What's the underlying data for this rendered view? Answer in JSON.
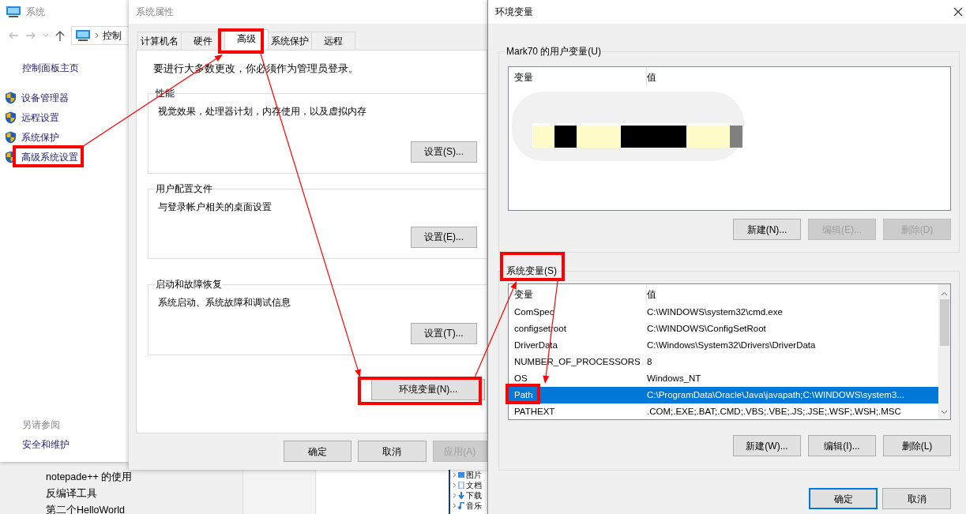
{
  "background_window": {
    "items": [
      {
        "label": "notepade++ 的使用"
      },
      {
        "label": "反编译工具"
      },
      {
        "label": "第二个HelloWorld"
      }
    ]
  },
  "explorer_tree": {
    "items": [
      {
        "label": "图片"
      },
      {
        "label": "文档"
      },
      {
        "label": "下载"
      },
      {
        "label": "音乐"
      }
    ]
  },
  "system_window": {
    "title": "系统",
    "address": "控制",
    "home_link": "控制面板主页",
    "tasks": [
      {
        "label": "设备管理器"
      },
      {
        "label": "远程设置"
      },
      {
        "label": "系统保护"
      },
      {
        "label": "高级系统设置"
      }
    ],
    "see_also_heading": "另请参阅",
    "see_also": [
      {
        "label": "安全和维护"
      }
    ]
  },
  "system_properties": {
    "title": "系统属性",
    "tabs": [
      {
        "label": "计算机名",
        "selected": false
      },
      {
        "label": "硬件",
        "selected": false
      },
      {
        "label": "高级",
        "selected": true
      },
      {
        "label": "系统保护",
        "selected": false
      },
      {
        "label": "远程",
        "selected": false
      }
    ],
    "admin_note": "要进行大多数更改，你必须作为管理员登录。",
    "groups": [
      {
        "title": "性能",
        "description": "视觉效果，处理器计划，内存使用，以及虚拟内存",
        "button": "设置(S)..."
      },
      {
        "title": "用户配置文件",
        "description": "与登录帐户相关的桌面设置",
        "button": "设置(E)..."
      },
      {
        "title": "启动和故障恢复",
        "description": "系统启动、系统故障和调试信息",
        "button": "设置(T)..."
      }
    ],
    "env_button": "环境变量(N)...",
    "buttons": [
      {
        "label": "确定",
        "disabled": false
      },
      {
        "label": "取消",
        "disabled": false
      },
      {
        "label": "应用(A)",
        "disabled": true
      }
    ]
  },
  "environment_variables": {
    "title": "环境变量",
    "user_vars": {
      "title": "Mark70 的用户变量(U)",
      "columns": [
        "变量",
        "值"
      ]
    },
    "user_buttons": [
      {
        "label": "新建(N)...",
        "disabled": false
      },
      {
        "label": "编辑(E)...",
        "disabled": true
      },
      {
        "label": "删除(D)",
        "disabled": true
      }
    ],
    "system_vars": {
      "title": "系统变量(S)",
      "columns": [
        "变量",
        "值"
      ],
      "rows": [
        {
          "name": "ComSpec",
          "value": "C:\\WINDOWS\\system32\\cmd.exe",
          "selected": false
        },
        {
          "name": "configsetroot",
          "value": "C:\\WINDOWS\\ConfigSetRoot",
          "selected": false
        },
        {
          "name": "DriverData",
          "value": "C:\\Windows\\System32\\Drivers\\DriverData",
          "selected": false
        },
        {
          "name": "NUMBER_OF_PROCESSORS",
          "value": "8",
          "selected": false
        },
        {
          "name": "OS",
          "value": "Windows_NT",
          "selected": false
        },
        {
          "name": "Path",
          "value": "C:\\ProgramData\\Oracle\\Java\\javapath;C:\\WINDOWS\\system3...",
          "selected": true
        },
        {
          "name": "PATHEXT",
          "value": ".COM;.EXE;.BAT;.CMD;.VBS;.VBE;.JS;.JSE;.WSF;.WSH;.MSC",
          "selected": false
        }
      ]
    },
    "system_buttons": [
      {
        "label": "新建(W)...",
        "disabled": false
      },
      {
        "label": "编辑(I)...",
        "disabled": false
      },
      {
        "label": "删除(L)",
        "disabled": false
      }
    ],
    "buttons": [
      {
        "label": "确定",
        "default": true
      },
      {
        "label": "取消",
        "default": false
      }
    ]
  }
}
